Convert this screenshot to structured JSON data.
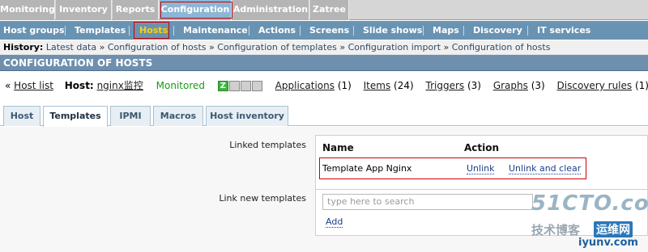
{
  "top_menu": {
    "items": [
      "Monitoring",
      "Inventory",
      "Reports",
      "Configuration",
      "Administration",
      "Zatree"
    ],
    "active": "Configuration"
  },
  "sub_menu": {
    "items": [
      "Host groups",
      "Templates",
      "Hosts",
      "Maintenance",
      "Actions",
      "Screens",
      "Slide shows",
      "Maps",
      "Discovery",
      "IT services"
    ],
    "active": "Hosts"
  },
  "history": {
    "label": "History:",
    "entries": [
      "Latest data",
      "Configuration of hosts",
      "Configuration of templates",
      "Configuration import",
      "Configuration of hosts"
    ],
    "separator": "»"
  },
  "page_title": "CONFIGURATION OF HOSTS",
  "host_info": {
    "back_prefix": "«",
    "host_list_label": "Host list",
    "host_label": "Host:",
    "host_name": "nginx监控",
    "status": "Monitored",
    "availability": [
      "Z",
      "",
      "",
      ""
    ],
    "links": [
      {
        "label": "Applications",
        "count": "(1)"
      },
      {
        "label": "Items",
        "count": "(24)"
      },
      {
        "label": "Triggers",
        "count": "(3)"
      },
      {
        "label": "Graphs",
        "count": "(3)"
      },
      {
        "label": "Discovery rules",
        "count": "(1)"
      }
    ]
  },
  "form_tabs": {
    "items": [
      "Host",
      "Templates",
      "IPMI",
      "Macros",
      "Host inventory"
    ],
    "active": "Templates"
  },
  "linked_templates": {
    "label": "Linked templates",
    "col_name": "Name",
    "col_action": "Action",
    "rows": [
      {
        "name": "Template App Nginx",
        "unlink": "Unlink",
        "unlink_clear": "Unlink and clear"
      }
    ]
  },
  "link_new": {
    "label": "Link new templates",
    "placeholder": "type here to search",
    "add_label": "Add"
  },
  "watermark": {
    "line1": "51CTO.com",
    "line2a": "技术博客",
    "line2b": "运维网",
    "line3": "iyunv.com"
  },
  "colors": {
    "submenu_bg": "#6993b3",
    "active_submenu_text": "#ffd100",
    "title_bg": "#6e8fad",
    "highlight_border": "#cc0000"
  }
}
